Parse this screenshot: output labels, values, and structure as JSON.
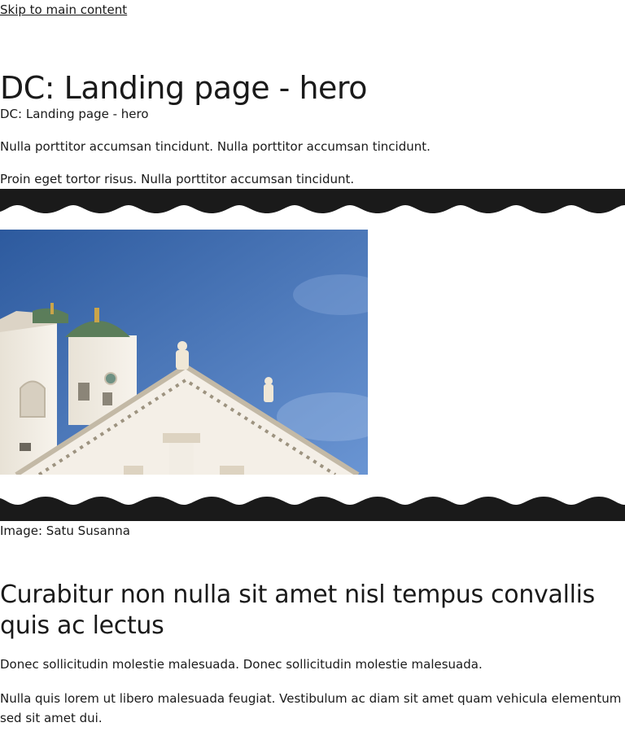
{
  "skip_link": "Skip to main content",
  "hero": {
    "title": "DC: Landing page - hero",
    "subtitle": "DC: Landing page - hero",
    "paragraph1": "Nulla porttitor accumsan tincidunt. Nulla porttitor accumsan tincidunt.",
    "paragraph2": "Proin eget tortor risus. Nulla porttitor accumsan tincidunt."
  },
  "image": {
    "caption": "Image: Satu Susanna"
  },
  "section": {
    "title": "Curabitur non nulla sit amet nisl tempus convallis quis ac lectus",
    "paragraph1": "Donec sollicitudin molestie malesuada. Donec sollicitudin molestie malesuada.",
    "paragraph2": "Nulla quis lorem ut libero malesuada feugiat. Vestibulum ac diam sit amet quam vehicula elementum sed sit amet dui."
  },
  "colors": {
    "text": "#1a1a1a",
    "koro": "#1a1a1a",
    "sky_top": "#2d5a9e",
    "sky_bottom": "#5b87c9",
    "building": "#efe9df",
    "dome": "#5b7d5a"
  }
}
